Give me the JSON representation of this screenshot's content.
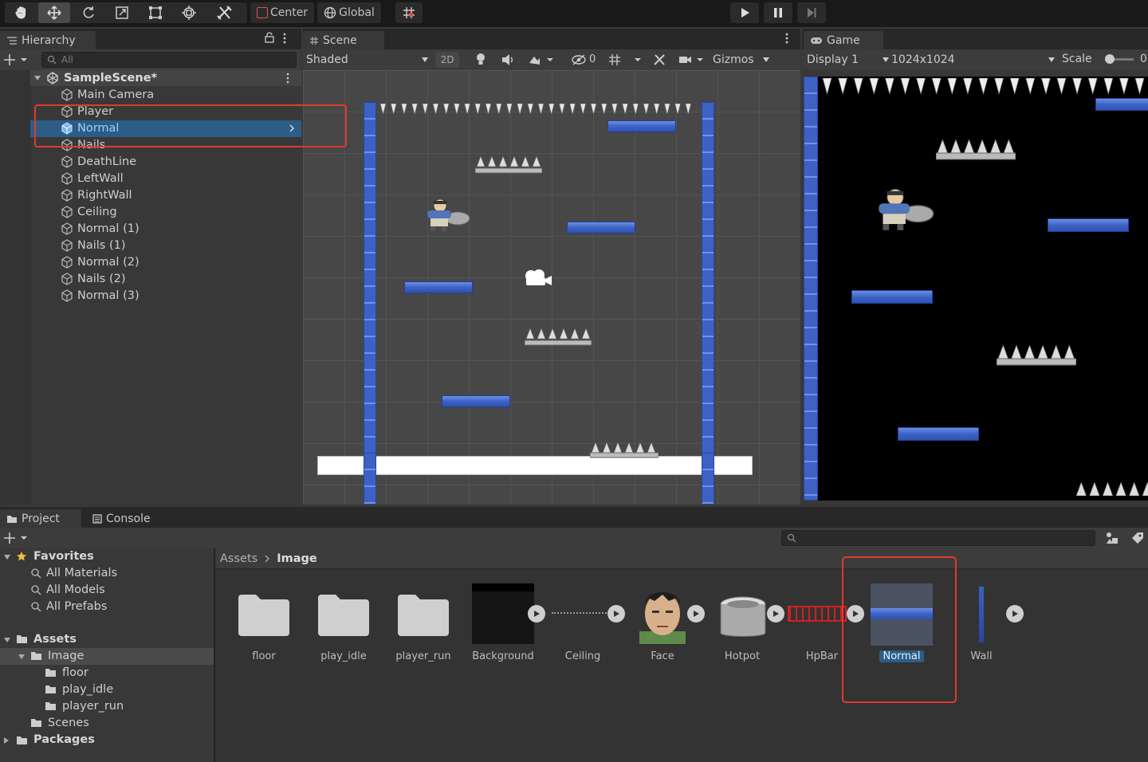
{
  "toolbar": {
    "pivot_label": "Center",
    "space_label": "Global",
    "tools": [
      "hand-icon",
      "move-icon",
      "rotate-icon",
      "scale-icon",
      "rect-icon",
      "transform-icon",
      "custom-tool-icon"
    ]
  },
  "hierarchy": {
    "tab_label": "Hierarchy",
    "search_placeholder": "All",
    "scene_name": "SampleScene*",
    "items": [
      {
        "label": "Main Camera"
      },
      {
        "label": "Player"
      },
      {
        "label": "Normal",
        "selected": true
      },
      {
        "label": "Nails"
      },
      {
        "label": "DeathLine"
      },
      {
        "label": "LeftWall"
      },
      {
        "label": "RightWall"
      },
      {
        "label": "Ceiling"
      },
      {
        "label": "Normal (1)"
      },
      {
        "label": "Nails (1)"
      },
      {
        "label": "Normal (2)"
      },
      {
        "label": "Nails (2)"
      },
      {
        "label": "Normal (3)"
      }
    ]
  },
  "scene": {
    "tab_label": "Scene",
    "shading_mode": "Shaded",
    "mode_2d": "2D",
    "hidden_count": "0",
    "gizmos_label": "Gizmos"
  },
  "game": {
    "tab_label": "Game",
    "display": "Display 1",
    "resolution": "1024x1024",
    "scale_label": "Scale",
    "scale_value": "0"
  },
  "project": {
    "tab_project": "Project",
    "tab_console": "Console",
    "favorites_label": "Favorites",
    "favorites": [
      "All Materials",
      "All Models",
      "All Prefabs"
    ],
    "assets_label": "Assets",
    "tree": [
      {
        "label": "Image",
        "level": 1,
        "open": true
      },
      {
        "label": "floor",
        "level": 2
      },
      {
        "label": "play_idle",
        "level": 2
      },
      {
        "label": "player_run",
        "level": 2
      },
      {
        "label": "Scenes",
        "level": 1
      }
    ],
    "packages_label": "Packages",
    "breadcrumb_root": "Assets",
    "breadcrumb_current": "Image",
    "assets": [
      {
        "label": "floor",
        "kind": "folder"
      },
      {
        "label": "play_idle",
        "kind": "folder"
      },
      {
        "label": "player_run",
        "kind": "folder"
      },
      {
        "label": "Background",
        "kind": "sprite"
      },
      {
        "label": "Ceiling",
        "kind": "sprite"
      },
      {
        "label": "Face",
        "kind": "sprite"
      },
      {
        "label": "Hotpot",
        "kind": "sprite"
      },
      {
        "label": "HpBar",
        "kind": "sprite"
      },
      {
        "label": "Normal",
        "kind": "sprite",
        "selected": true
      },
      {
        "label": "Wall",
        "kind": "sprite"
      }
    ]
  },
  "colors": {
    "selection": "#2c5d87",
    "highlight_box": "#e2392c",
    "platform_blue": "#3d63c8"
  }
}
